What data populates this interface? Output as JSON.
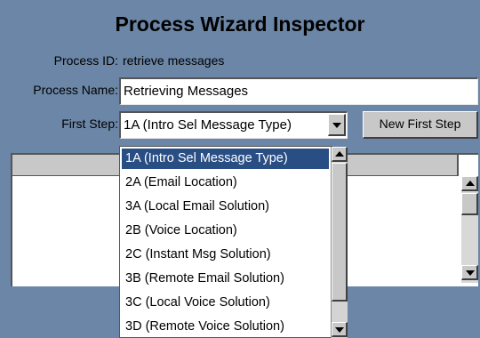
{
  "window": {
    "title": "Process Wizard Inspector"
  },
  "process_id": {
    "label": "Process ID:",
    "value": "retrieve messages"
  },
  "process_name": {
    "label": "Process Name:",
    "value": "Retrieving Messages"
  },
  "first_step": {
    "label": "First Step:",
    "selected": "1A (Intro Sel Message Type)"
  },
  "new_first_step_button": "New First Step",
  "dropdown_options": [
    "1A (Intro Sel Message Type)",
    "2A (Email Location)",
    "3A (Local Email Solution)",
    "2B (Voice Location)",
    "2C (Instant Msg Solution)",
    "3B (Remote Email Solution)",
    "3C (Local Voice Solution)",
    "3D (Remote Voice Solution)"
  ],
  "colors": {
    "background": "#6b86a6",
    "selection": "#294e84",
    "control": "#c8c8c8"
  }
}
